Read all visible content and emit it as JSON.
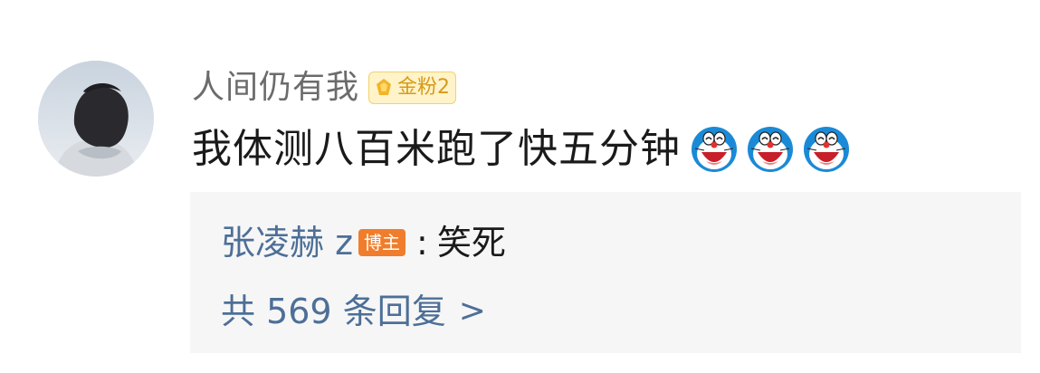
{
  "comment": {
    "username": "人间仍有我",
    "fan_badge": {
      "label": "金粉2",
      "icon": "diamond-icon",
      "color": "#f2b42a"
    },
    "text": "我体测八百米跑了快五分钟",
    "emojis": [
      "doraemon-laugh-icon",
      "doraemon-laugh-icon",
      "doraemon-laugh-icon"
    ]
  },
  "reply": {
    "author": "张凌赫 z",
    "author_badge": "博主",
    "separator": ":",
    "text": "笑死",
    "count_text": "共 569 条回复",
    "chevron": ">"
  },
  "colors": {
    "link_blue": "#4d6f97",
    "badge_orange": "#f07d2b",
    "reply_bg": "#f6f6f6"
  }
}
